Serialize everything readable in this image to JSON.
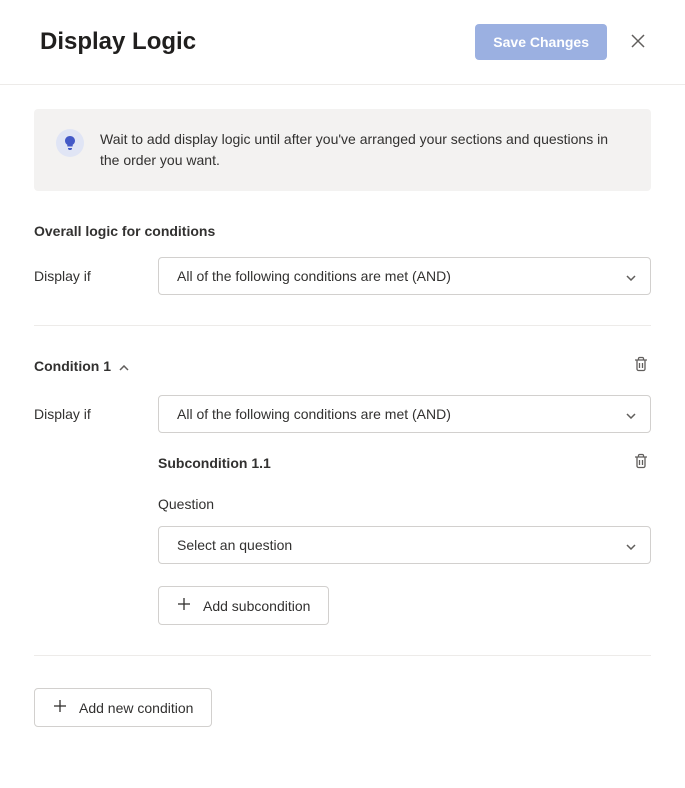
{
  "header": {
    "title": "Display Logic",
    "save_label": "Save Changes"
  },
  "banner": {
    "text": "Wait to add display logic until after you've arranged your sections and questions in the order you want."
  },
  "overall": {
    "section_label": "Overall logic for conditions",
    "display_if_label": "Display if",
    "display_if_value": "All of the following conditions are met (AND)"
  },
  "condition1": {
    "title": "Condition 1",
    "display_if_label": "Display if",
    "display_if_value": "All of the following conditions are met (AND)",
    "subcondition": {
      "title": "Subcondition 1.1",
      "question_label": "Question",
      "question_value": "Select an question",
      "add_subcondition_label": "Add subcondition"
    }
  },
  "add_condition_label": "Add new condition"
}
